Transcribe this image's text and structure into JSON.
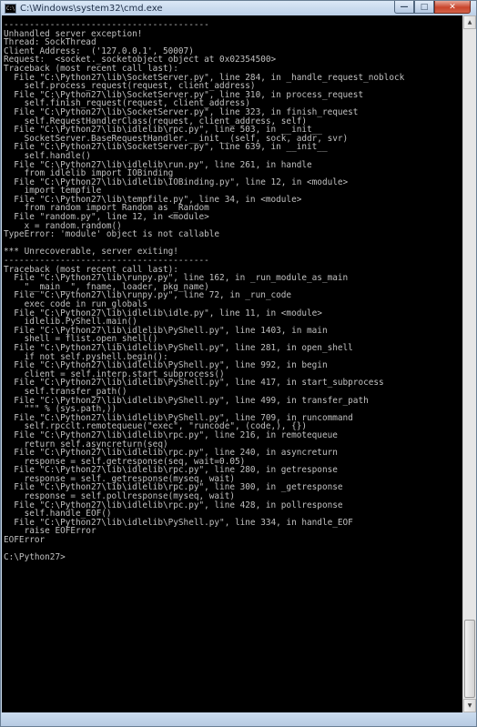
{
  "window": {
    "title": "C:\\Windows\\system32\\cmd.exe",
    "icon_label": "C:\\",
    "icon": "cmd-app-icon",
    "buttons": {
      "minimize_glyph": "—",
      "maximize_glyph": "□",
      "close_glyph": "✕"
    }
  },
  "console": {
    "lines": [
      "----------------------------------------",
      "Unhandled server exception!",
      "Thread: SockThread",
      "Client Address:  ('127.0.0.1', 50007)",
      "Request:  <socket._socketobject object at 0x02354500>",
      "Traceback (most recent call last):",
      "  File \"C:\\Python27\\lib\\SocketServer.py\", line 284, in _handle_request_noblock",
      "    self.process_request(request, client_address)",
      "  File \"C:\\Python27\\lib\\SocketServer.py\", line 310, in process_request",
      "    self.finish_request(request, client_address)",
      "  File \"C:\\Python27\\lib\\SocketServer.py\", line 323, in finish_request",
      "    self.RequestHandlerClass(request, client_address, self)",
      "  File \"C:\\Python27\\lib\\idlelib\\rpc.py\", line 503, in __init__",
      "    SocketServer.BaseRequestHandler.__init__(self, sock, addr, svr)",
      "  File \"C:\\Python27\\lib\\SocketServer.py\", line 639, in __init__",
      "    self.handle()",
      "  File \"C:\\Python27\\lib\\idlelib\\run.py\", line 261, in handle",
      "    from idlelib import IOBinding",
      "  File \"C:\\Python27\\lib\\idlelib\\IOBinding.py\", line 12, in <module>",
      "    import tempfile",
      "  File \"C:\\Python27\\lib\\tempfile.py\", line 34, in <module>",
      "    from random import Random as _Random",
      "  File \"random.py\", line 12, in <module>",
      "    x = random.random()",
      "TypeError: 'module' object is not callable",
      "",
      "*** Unrecoverable, server exiting!",
      "----------------------------------------",
      "Traceback (most recent call last):",
      "  File \"C:\\Python27\\lib\\runpy.py\", line 162, in _run_module_as_main",
      "    \"__main__\", fname, loader, pkg_name)",
      "  File \"C:\\Python27\\lib\\runpy.py\", line 72, in _run_code",
      "    exec code in run_globals",
      "  File \"C:\\Python27\\lib\\idlelib\\idle.py\", line 11, in <module>",
      "    idlelib.PyShell.main()",
      "  File \"C:\\Python27\\lib\\idlelib\\PyShell.py\", line 1403, in main",
      "    shell = flist.open_shell()",
      "  File \"C:\\Python27\\lib\\idlelib\\PyShell.py\", line 281, in open_shell",
      "    if not self.pyshell.begin():",
      "  File \"C:\\Python27\\lib\\idlelib\\PyShell.py\", line 992, in begin",
      "    client = self.interp.start_subprocess()",
      "  File \"C:\\Python27\\lib\\idlelib\\PyShell.py\", line 417, in start_subprocess",
      "    self.transfer_path()",
      "  File \"C:\\Python27\\lib\\idlelib\\PyShell.py\", line 499, in transfer_path",
      "    \"\"\" % (sys.path,))",
      "  File \"C:\\Python27\\lib\\idlelib\\PyShell.py\", line 709, in runcommand",
      "    self.rpcclt.remotequeue(\"exec\", \"runcode\", (code,), {})",
      "  File \"C:\\Python27\\lib\\idlelib\\rpc.py\", line 216, in remotequeue",
      "    return self.asyncreturn(seq)",
      "  File \"C:\\Python27\\lib\\idlelib\\rpc.py\", line 240, in asyncreturn",
      "    response = self.getresponse(seq, wait=0.05)",
      "  File \"C:\\Python27\\lib\\idlelib\\rpc.py\", line 280, in getresponse",
      "    response = self._getresponse(myseq, wait)",
      "  File \"C:\\Python27\\lib\\idlelib\\rpc.py\", line 300, in _getresponse",
      "    response = self.pollresponse(myseq, wait)",
      "  File \"C:\\Python27\\lib\\idlelib\\rpc.py\", line 428, in pollresponse",
      "    self.handle_EOF()",
      "  File \"C:\\Python27\\lib\\idlelib\\PyShell.py\", line 334, in handle_EOF",
      "    raise EOFError",
      "EOFError",
      "",
      "C:\\Python27>"
    ]
  },
  "scrollbar": {
    "up_arrow": "▲",
    "down_arrow": "▼",
    "position_fraction": 0.97
  },
  "colors": {
    "console_background": "#000000",
    "console_text": "#c0c0c0",
    "titlebar": "#c6d7ea",
    "close_button": "#c9452c"
  }
}
